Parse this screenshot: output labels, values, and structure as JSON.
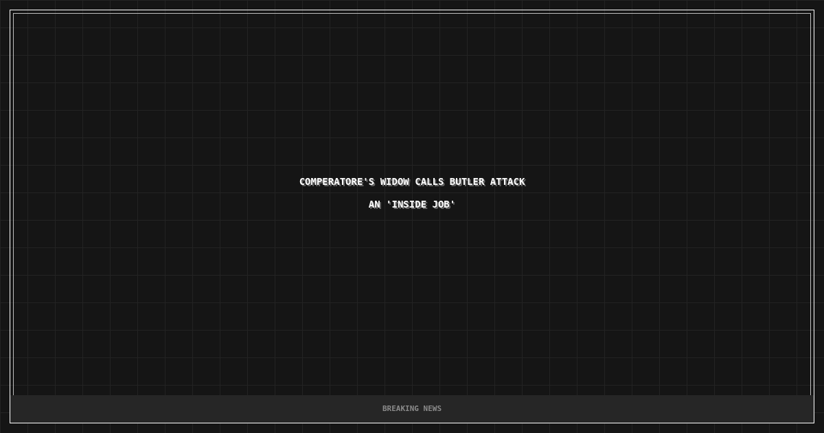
{
  "headline": [
    "COMPERATORE'S WIDOW CALLS BUTLER ATTACK",
    "AN 'INSIDE JOB'"
  ],
  "footer": {
    "label": "BREAKING NEWS"
  }
}
